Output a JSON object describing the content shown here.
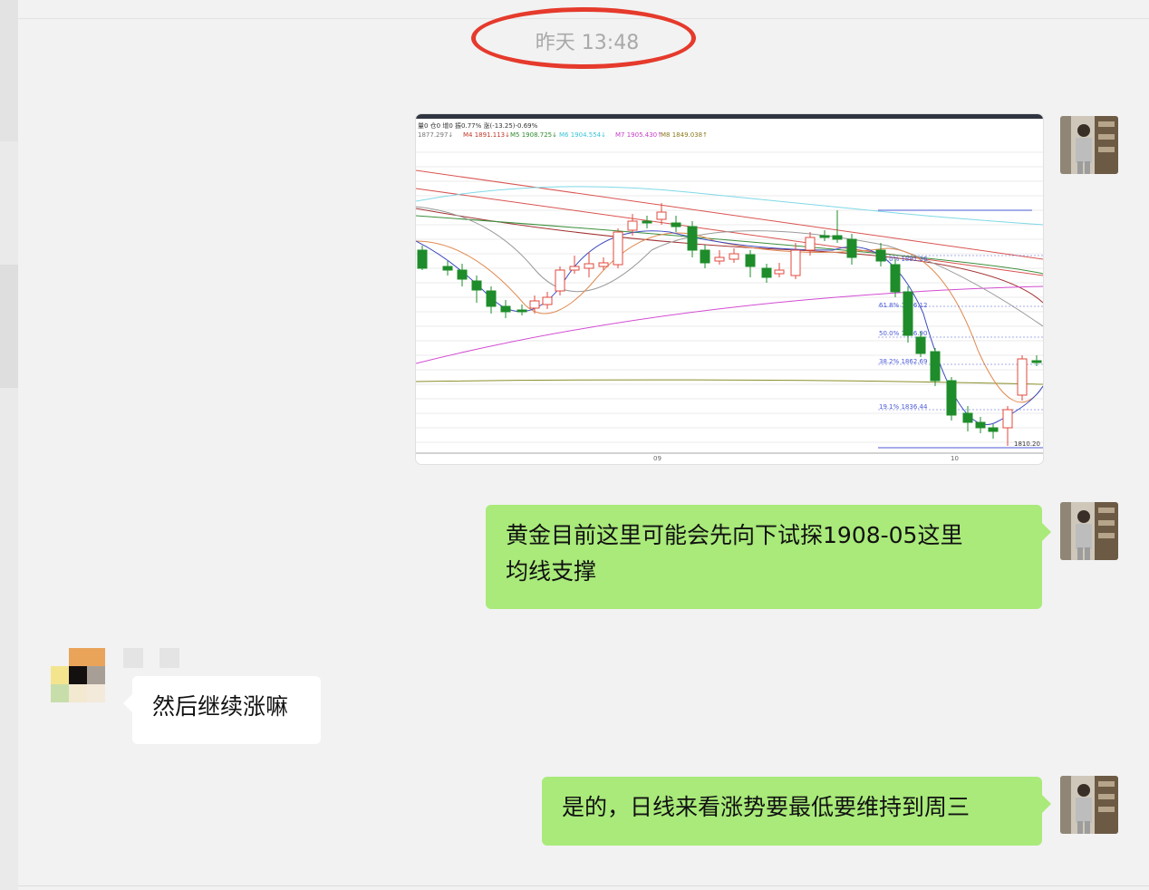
{
  "chat": {
    "timestamp": "昨天 13:48",
    "messages": [
      {
        "sender": "me",
        "type": "image",
        "description_label": "gold chart screenshot"
      },
      {
        "sender": "me",
        "type": "text",
        "lines": [
          "黄金目前这里可能会先向下试探1908-05这里",
          "均线支撑"
        ]
      },
      {
        "sender": "other",
        "type": "text",
        "text": "然后继续涨嘛"
      },
      {
        "sender": "me",
        "type": "text",
        "text": "是的，日线来看涨势要最低要维持到周三"
      }
    ]
  },
  "chart": {
    "header_line1": "量0  仓0  增0  振0.77%  涨(-13.25)-0.69%",
    "header_line2_a": "1877.297↓",
    "header_line2_b": "M4 1891.113↓",
    "header_line2_c": "M5 1908.725↓",
    "header_line2_d": "M6 1904.554↓",
    "header_line2_e": "M7 1905.430↑",
    "header_line2_f": "M8 1849.038↑",
    "fib_labels": [
      "50.0%  1891.36",
      "61.8%  1886.12",
      "50.0%  1876.90",
      "38.2%  1862.69",
      "19.1%  1836.44"
    ],
    "low_label": "1810.20",
    "xaxis_labels": [
      "09",
      "10"
    ],
    "colors": {
      "up": "#e0483c",
      "down": "#1e8c2a",
      "fib": "#4b5bd6"
    }
  },
  "colors": {
    "bubble_me": "#a9ea7a",
    "bubble_other": "#ffffff",
    "circle": "#e53a2c",
    "background": "#f2f2f2"
  }
}
